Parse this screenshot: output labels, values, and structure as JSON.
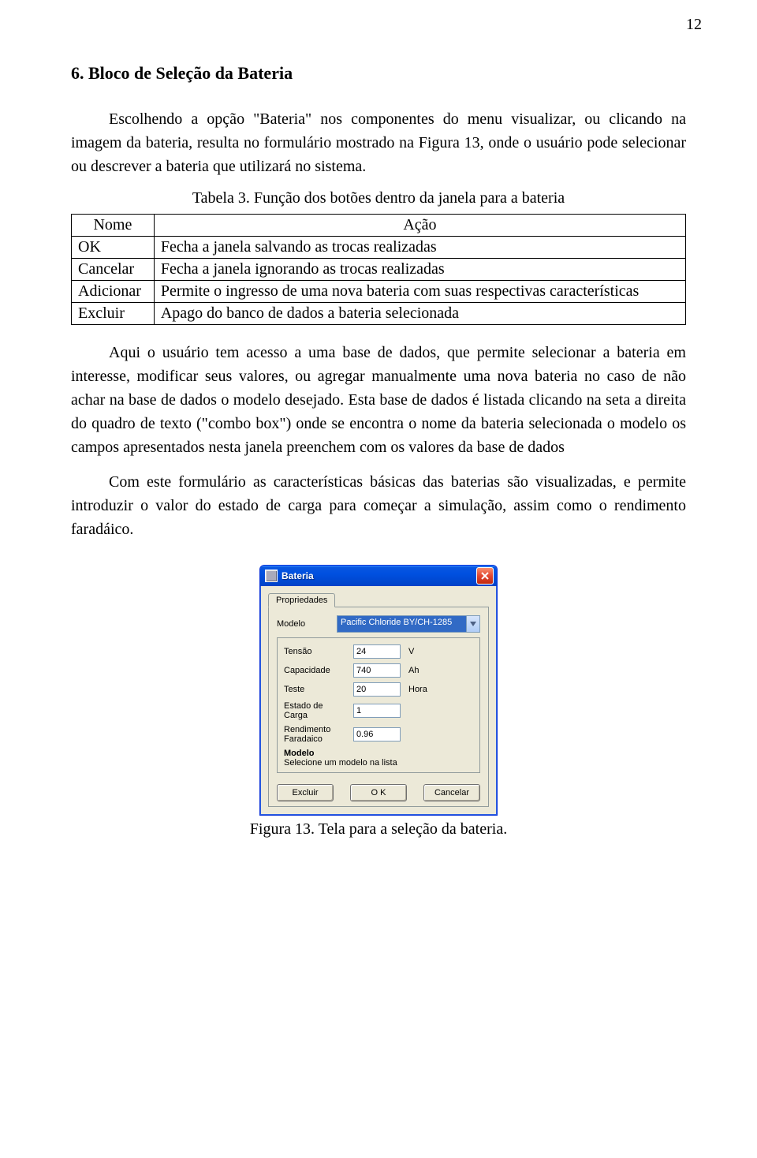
{
  "page_number": "12",
  "heading": "6. Bloco de Seleção da Bateria",
  "para1": "Escolhendo a opção \"Bateria\" nos componentes do menu visualizar, ou clicando na imagem da bateria, resulta no formulário mostrado na Figura 13, onde o usuário pode selecionar ou descrever a bateria que utilizará no sistema.",
  "table_caption": "Tabela 3. Função dos botões dentro da janela para a bateria",
  "table": {
    "head": {
      "nome": "Nome",
      "acao": "Ação"
    },
    "rows": [
      {
        "nome": "OK",
        "acao": "Fecha a janela salvando as trocas realizadas"
      },
      {
        "nome": "Cancelar",
        "acao": "Fecha a janela ignorando as trocas realizadas"
      },
      {
        "nome": "Adicionar",
        "acao": "Permite o ingresso de uma nova bateria com suas respectivas características"
      },
      {
        "nome": "Excluir",
        "acao": "Apago do banco de dados a bateria selecionada"
      }
    ]
  },
  "para2": "Aqui o usuário tem acesso a uma base de dados, que permite selecionar a bateria em interesse, modificar seus valores, ou agregar manualmente uma nova bateria no caso de não achar na base de dados o modelo desejado. Esta base de dados é listada clicando na seta a direita do quadro de texto (\"combo box\") onde se encontra o nome da bateria selecionada o modelo os campos  apresentados nesta janela preenchem com os valores da base de dados",
  "para3": "Com este formulário as características básicas das baterias são visualizadas, e permite introduzir o valor do estado de carga para começar a simulação, assim como o rendimento faradáico.",
  "dialog": {
    "title": "Bateria",
    "tab": "Propriedades",
    "modelo_label": "Modelo",
    "modelo_value": "Pacific Chloride BY/CH-1285",
    "fields": {
      "tensao": {
        "label": "Tensão",
        "value": "24",
        "unit": "V"
      },
      "capacidade": {
        "label": "Capacidade",
        "value": "740",
        "unit": "Ah"
      },
      "teste": {
        "label": "Teste",
        "value": "20",
        "unit": "Hora"
      },
      "estado": {
        "label": "Estado de Carga",
        "value": "1",
        "unit": ""
      },
      "rendimento": {
        "label": "Rendimento Faradaico",
        "value": "0.96",
        "unit": ""
      }
    },
    "help_title": "Modelo",
    "help_text": "Selecione um modelo na lista",
    "btn_excluir": "Excluir",
    "btn_ok": "O K",
    "btn_cancelar": "Cancelar"
  },
  "figure_caption": "Figura 13. Tela para a seleção da bateria."
}
